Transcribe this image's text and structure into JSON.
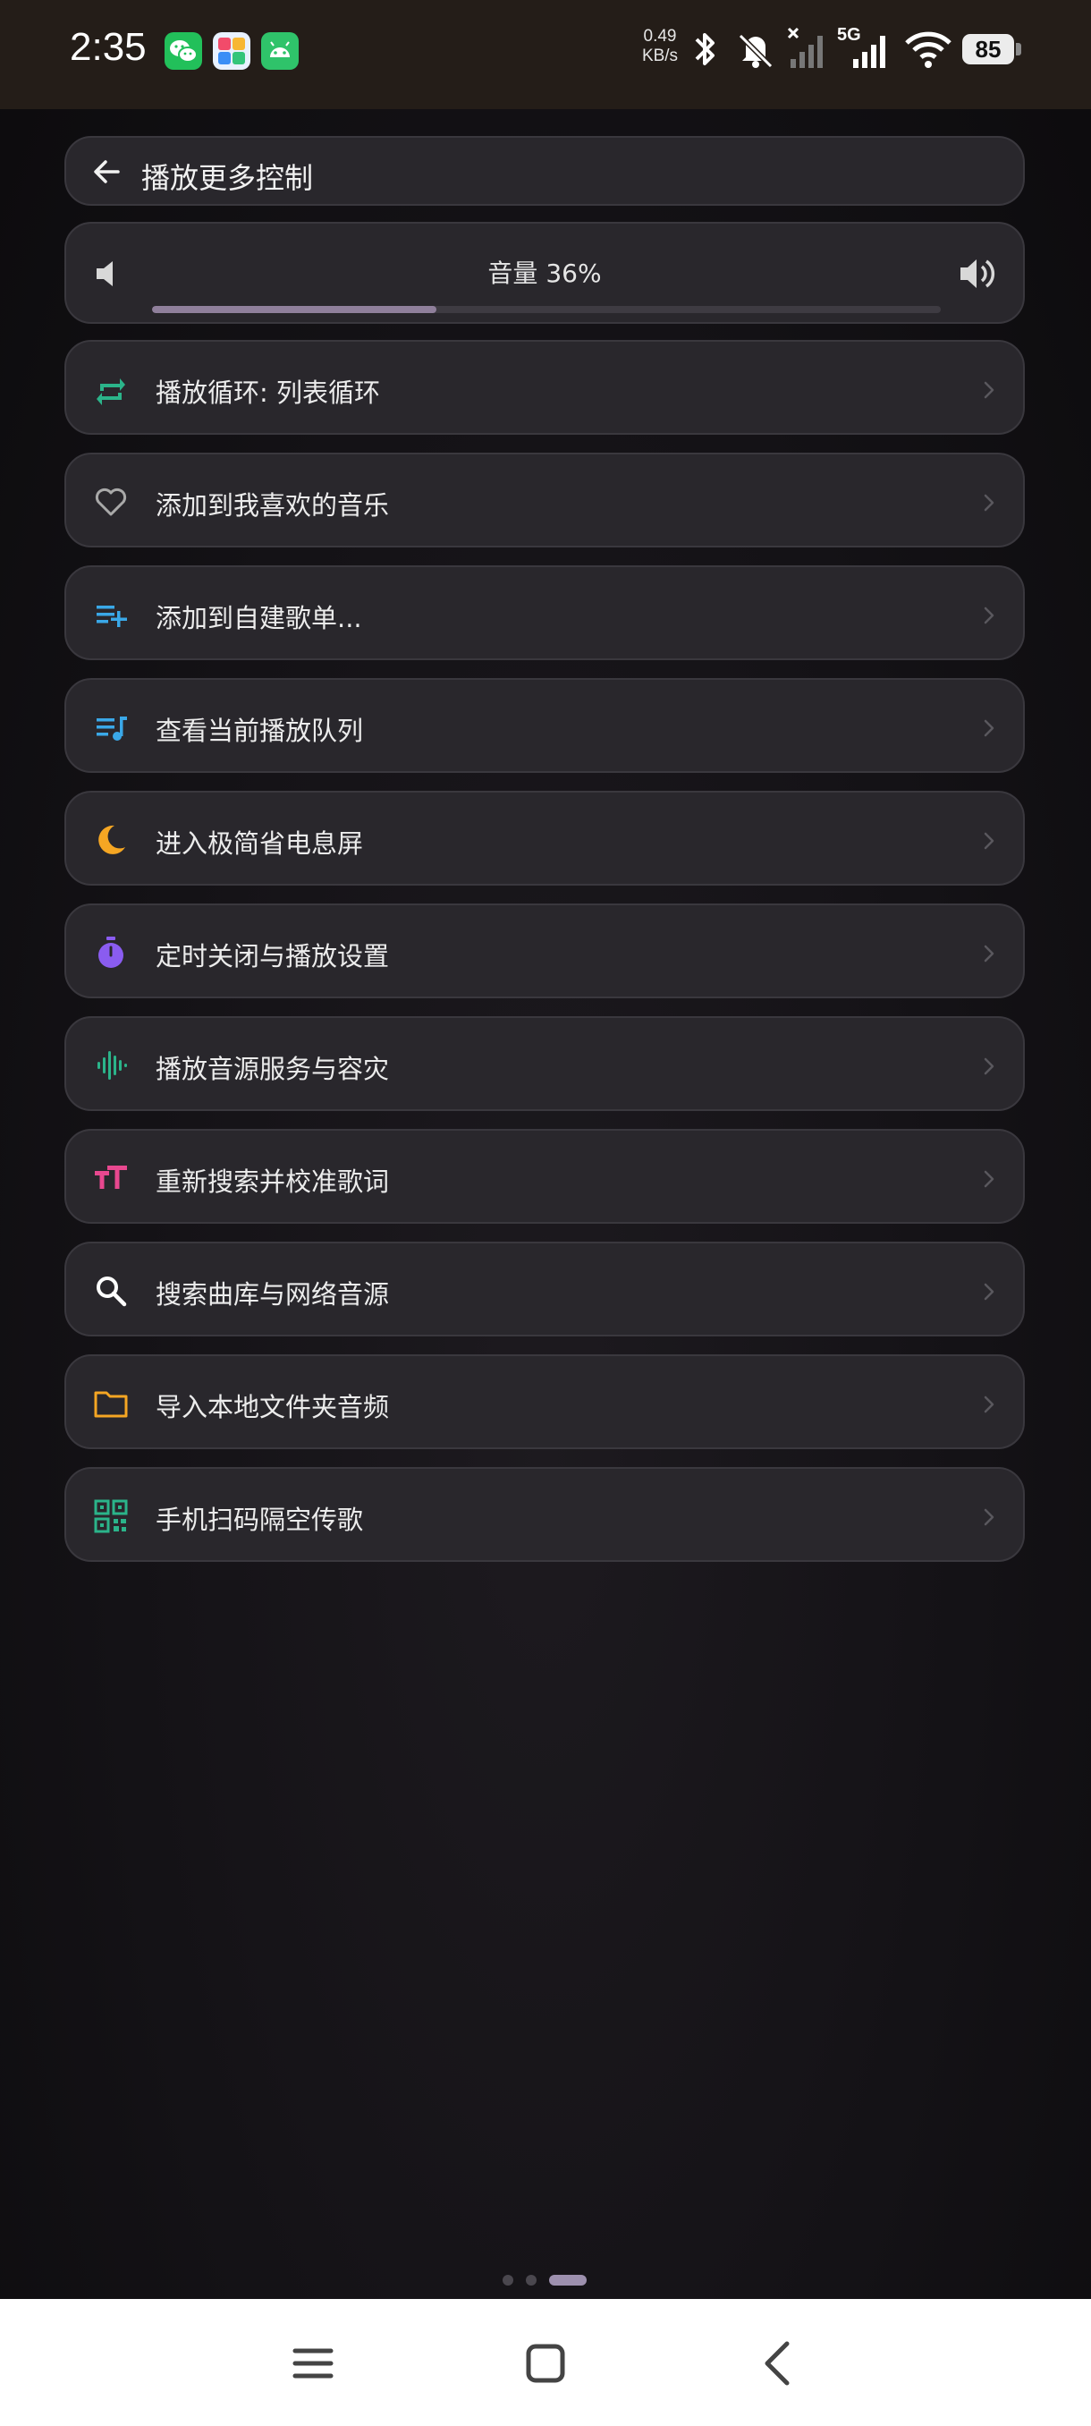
{
  "status_bar": {
    "time": "2:35",
    "net_speed_value": "0.49",
    "net_speed_unit": "KB/s",
    "network_type": "5G",
    "battery": "85"
  },
  "header": {
    "title": "播放更多控制"
  },
  "volume": {
    "label": "音量 36%",
    "level_percent": 36
  },
  "menu": [
    {
      "label": "播放循环: 列表循环",
      "icon": "repeat-icon",
      "color": "#2bb48a"
    },
    {
      "label": "添加到我喜欢的音乐",
      "icon": "heart-icon",
      "color": "#a9a9a9"
    },
    {
      "label": "添加到自建歌单...",
      "icon": "playlist-add-icon",
      "color": "#3aa8e8"
    },
    {
      "label": "查看当前播放队列",
      "icon": "queue-music-icon",
      "color": "#3aa8e8"
    },
    {
      "label": "进入极简省电息屏",
      "icon": "moon-icon",
      "color": "#f5a623"
    },
    {
      "label": "定时关闭与播放设置",
      "icon": "timer-icon",
      "color": "#8a5cf0"
    },
    {
      "label": "播放音源服务与容灾",
      "icon": "waveform-icon",
      "color": "#2bb48a"
    },
    {
      "label": "重新搜索并校准歌词",
      "icon": "text-size-icon",
      "color": "#e8488f"
    },
    {
      "label": "搜索曲库与网络音源",
      "icon": "search-icon",
      "color": "#ffffff"
    },
    {
      "label": "导入本地文件夹音频",
      "icon": "folder-icon",
      "color": "#f5a623"
    },
    {
      "label": "手机扫码隔空传歌",
      "icon": "qr-code-icon",
      "color": "#2bb48a"
    }
  ],
  "pager": {
    "pages": 3,
    "active_page": 3
  }
}
